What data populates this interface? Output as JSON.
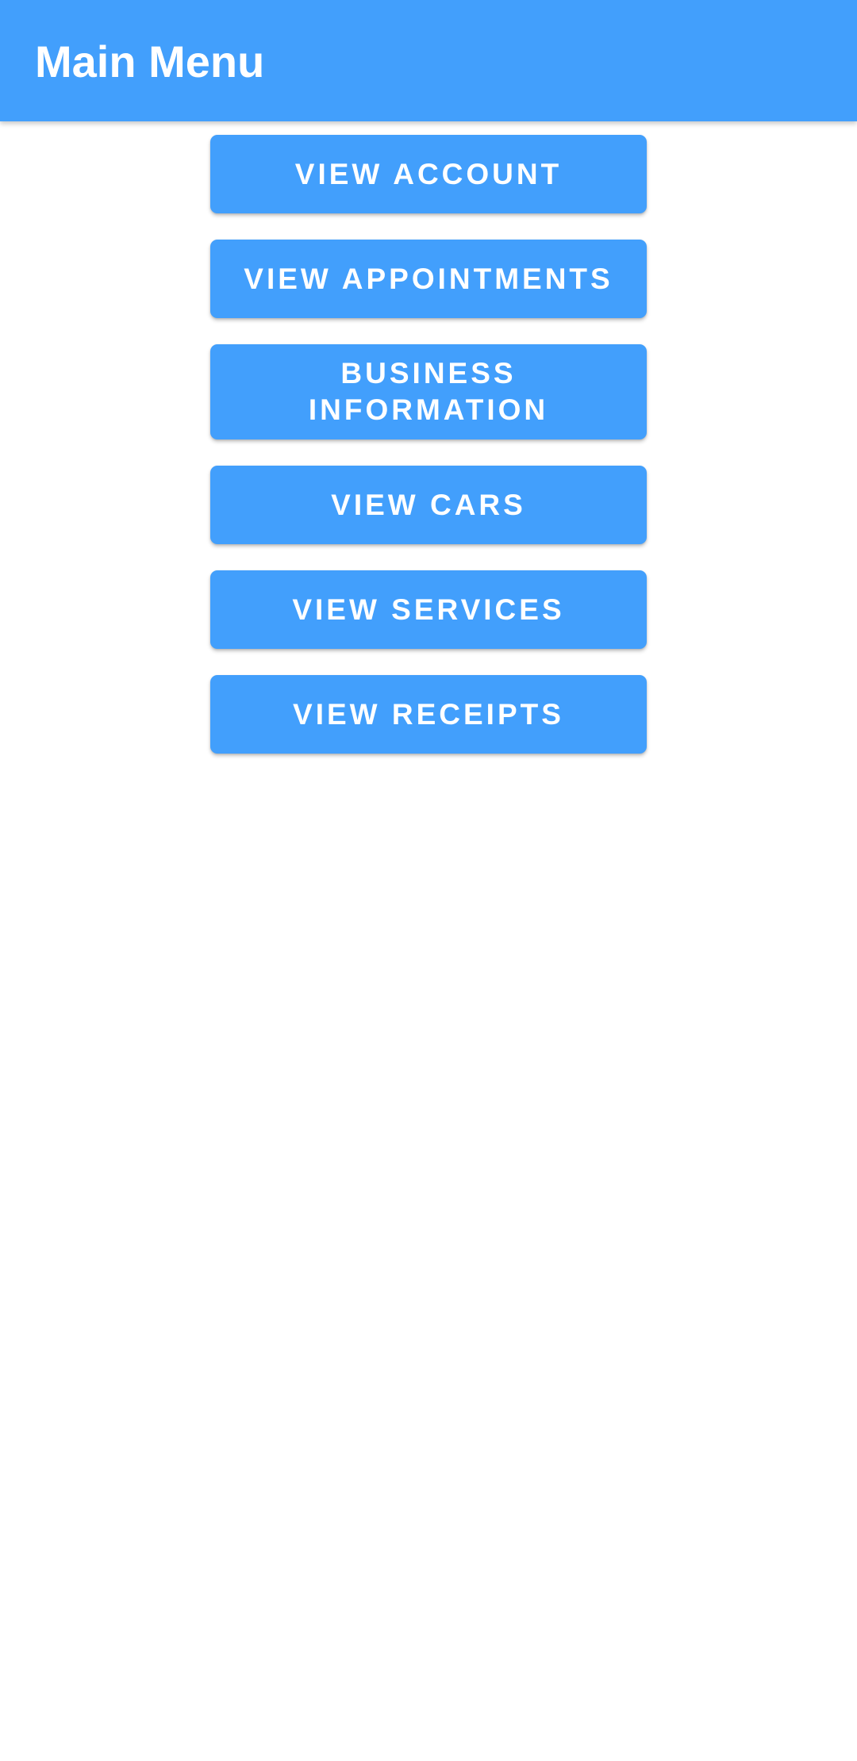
{
  "app_bar": {
    "title": "Main Menu"
  },
  "menu": {
    "buttons": [
      {
        "label": "VIEW ACCOUNT"
      },
      {
        "label": "VIEW APPOINTMENTS"
      },
      {
        "label": "BUSINESS INFORMATION"
      },
      {
        "label": "VIEW CARS"
      },
      {
        "label": "VIEW SERVICES"
      },
      {
        "label": "VIEW RECEIPTS"
      }
    ]
  },
  "colors": {
    "primary": "#429ffc",
    "on_primary": "#ffffff",
    "background": "#ffffff"
  }
}
